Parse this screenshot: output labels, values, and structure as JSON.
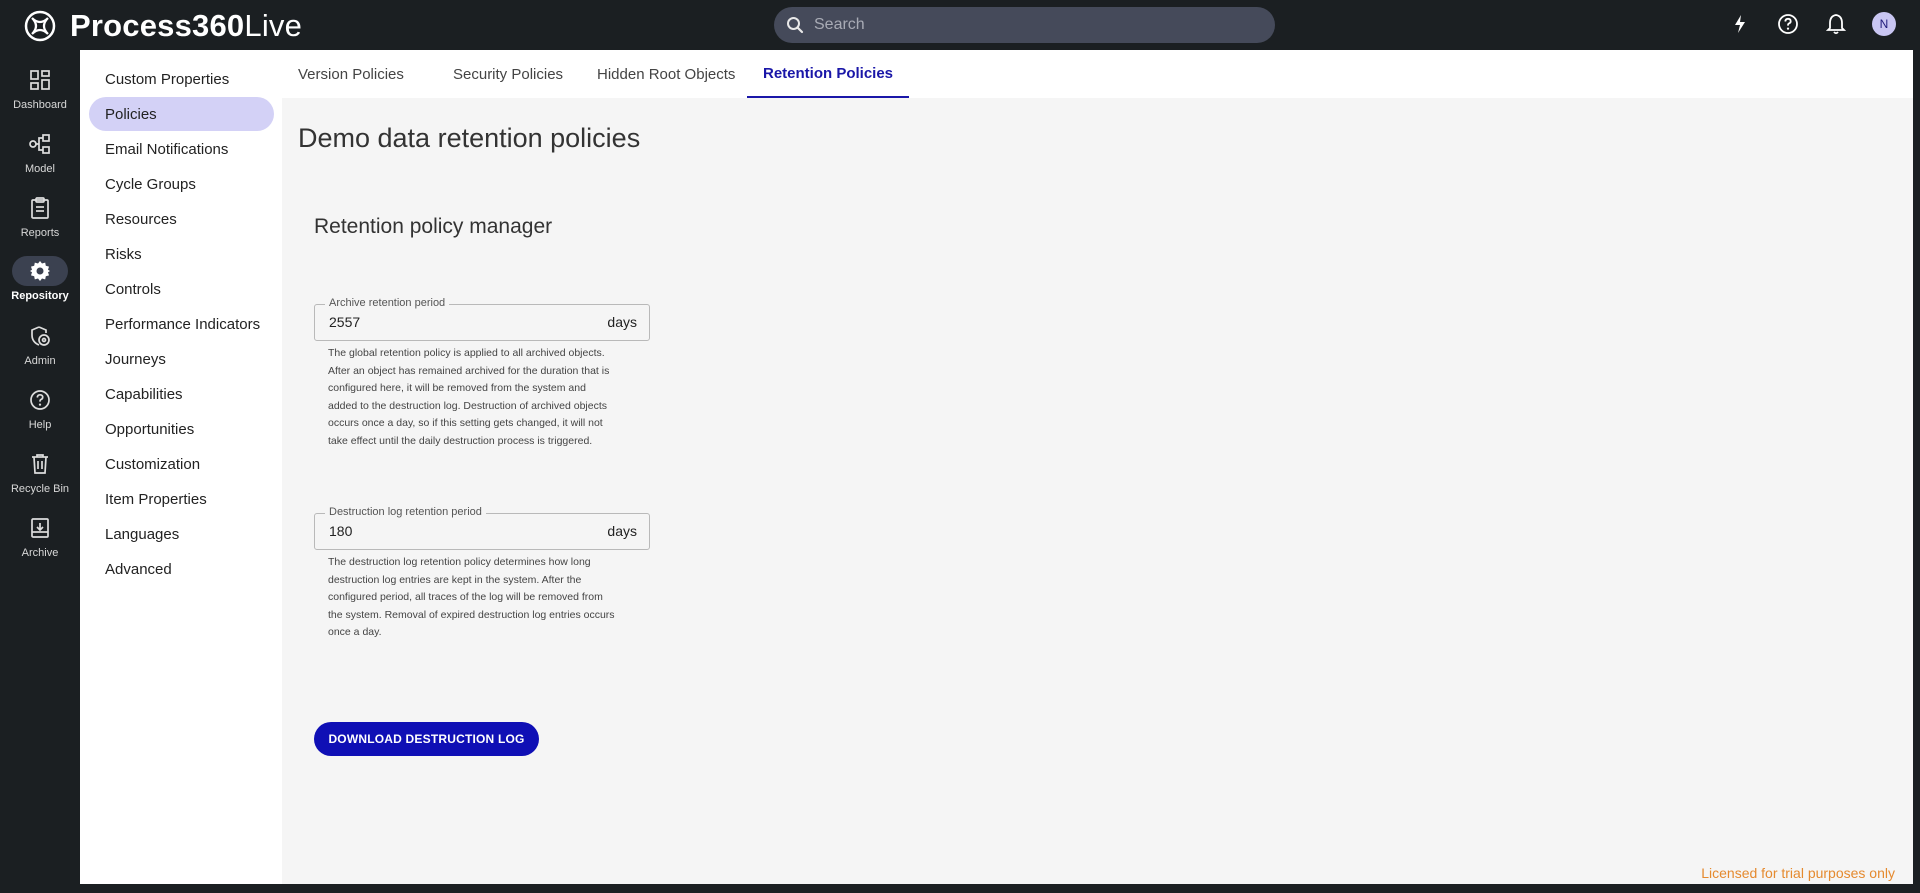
{
  "app": {
    "name_bold": "Process360",
    "name_light": "Live"
  },
  "search": {
    "placeholder": "Search"
  },
  "rail": {
    "items": [
      {
        "label": "Dashboard",
        "icon": "dashboard-icon"
      },
      {
        "label": "Model",
        "icon": "model-icon"
      },
      {
        "label": "Reports",
        "icon": "reports-icon"
      },
      {
        "label": "Repository",
        "icon": "gear-icon",
        "active": true
      },
      {
        "label": "Admin",
        "icon": "admin-icon"
      },
      {
        "label": "Help",
        "icon": "help-icon"
      },
      {
        "label": "Recycle Bin",
        "icon": "trash-icon"
      },
      {
        "label": "Archive",
        "icon": "archive-icon"
      }
    ]
  },
  "user": {
    "initial": "N"
  },
  "subnav": {
    "items": [
      "Custom Properties",
      "Policies",
      "Email Notifications",
      "Cycle Groups",
      "Resources",
      "Risks",
      "Controls",
      "Performance Indicators",
      "Journeys",
      "Capabilities",
      "Opportunities",
      "Customization",
      "Item Properties",
      "Languages",
      "Advanced"
    ],
    "active": "Policies"
  },
  "tabs": [
    "Version Policies",
    "Security Policies",
    "Hidden Root Objects",
    "Retention Policies"
  ],
  "active_tab": "Retention Policies",
  "page": {
    "title": "Demo data retention policies",
    "section_title": "Retention policy manager"
  },
  "archive_field": {
    "label": "Archive retention period",
    "value": "2557",
    "unit": "days",
    "help": [
      "The global retention policy is applied to all archived objects.",
      "After an object has remained archived for the duration that is",
      "configured here, it will be removed from the system and",
      "added to the destruction log. Destruction of archived objects",
      "occurs once a day, so if this setting gets changed, it will not",
      "take effect until the daily destruction process is triggered."
    ]
  },
  "destruction_field": {
    "label": "Destruction log retention period",
    "value": "180",
    "unit": "days",
    "help": [
      "The destruction log retention policy determines how long",
      "destruction log entries are kept in the system. After the",
      "configured period, all traces of the log will be removed from",
      "the system. Removal of expired destruction log entries occurs",
      "once a day."
    ]
  },
  "download_button": "DOWNLOAD DESTRUCTION LOG",
  "license_note": "Licensed for trial purposes only",
  "colors": {
    "accent": "#1a17a8",
    "button": "#0f0fb5",
    "license": "#e58a2f",
    "active_nav": "#d3d1f6"
  }
}
